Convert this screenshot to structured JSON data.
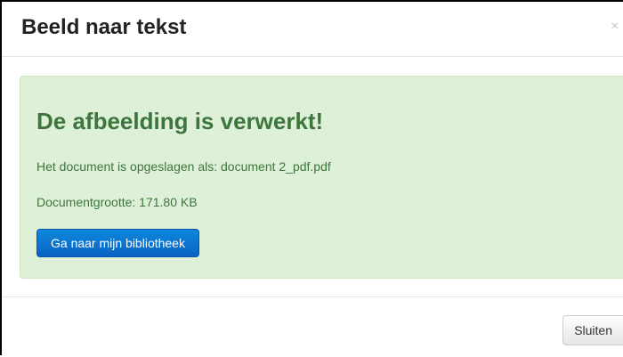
{
  "dialog": {
    "title": "Beeld naar tekst",
    "close_glyph": "×"
  },
  "alert": {
    "heading": "De afbeelding is verwerkt!",
    "saved_line": "Het document is opgeslagen als: document 2_pdf.pdf",
    "size_line": "Documentgrootte: 171.80 KB",
    "library_button_label": "Ga naar mijn bibliotheek"
  },
  "footer": {
    "close_button_label": "Sluiten"
  },
  "colors": {
    "success_background": "#dff0d8",
    "success_text": "#3c763d",
    "primary_button": "#0a62c3"
  }
}
